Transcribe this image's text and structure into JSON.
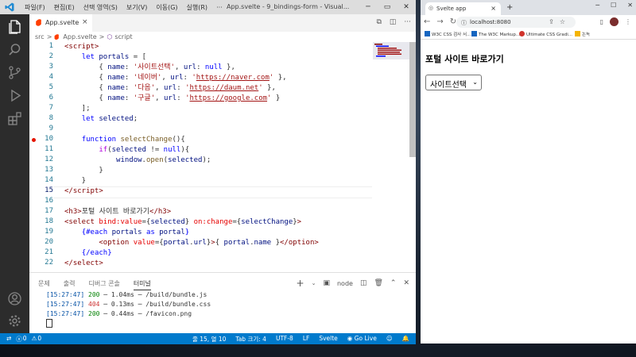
{
  "vscode": {
    "menus": [
      "파일(F)",
      "편집(E)",
      "선택 영역(S)",
      "보기(V)",
      "이동(G)",
      "실행(R)",
      "···"
    ],
    "window_title": "App.svelte - 9_bindings-form - Visual...",
    "tab": {
      "label": "App.svelte",
      "close": "×"
    },
    "breadcrumb": [
      "src",
      ">",
      "App.svelte",
      ">",
      "script"
    ],
    "line_numbers": [
      "1",
      "2",
      "3",
      "4",
      "5",
      "6",
      "7",
      "8",
      "9",
      "10",
      "11",
      "12",
      "13",
      "14",
      "15",
      "16",
      "17",
      "18",
      "19",
      "20",
      "21",
      "22"
    ],
    "current_line": "15",
    "breakpoint_line": "10",
    "panel_tabs": [
      "문제",
      "출력",
      "디버그 콘솔",
      "터미널"
    ],
    "active_panel_tab": "터미널",
    "terminal_label": "node",
    "terminal_lines": [
      {
        "time": "[15:27:47]",
        "status": "200",
        "timing": " ─ 1.04ms ─ /build/bundle.js"
      },
      {
        "time": "[15:27:47]",
        "status": "404",
        "timing": " ─ 0.13ms ─ /build/bundle.css"
      },
      {
        "time": "[15:27:47]",
        "status": "200",
        "timing": " ─ 0.44ms ─ /favicon.png"
      }
    ],
    "status": {
      "errors": "0",
      "warnings": "0",
      "position": "줄 15, 열 10",
      "tab_size": "Tab 크기: 4",
      "encoding": "UTF-8",
      "eol": "LF",
      "language": "Svelte",
      "go_live": "Go Live"
    },
    "colors": {
      "statusbar": "#007acc",
      "activitybar": "#2c2c2c",
      "titlebar": "#dddddd"
    }
  },
  "browser": {
    "tab_title": "Svelte app",
    "url": "localhost:8080",
    "bookmarks": [
      "W3C CSS 검사 서...",
      "The W3C Markup...",
      "Ultimate CSS Gradi...",
      "논녹"
    ],
    "page_heading": "포털 사이트 바로가기",
    "select_value": "사이트선택"
  }
}
